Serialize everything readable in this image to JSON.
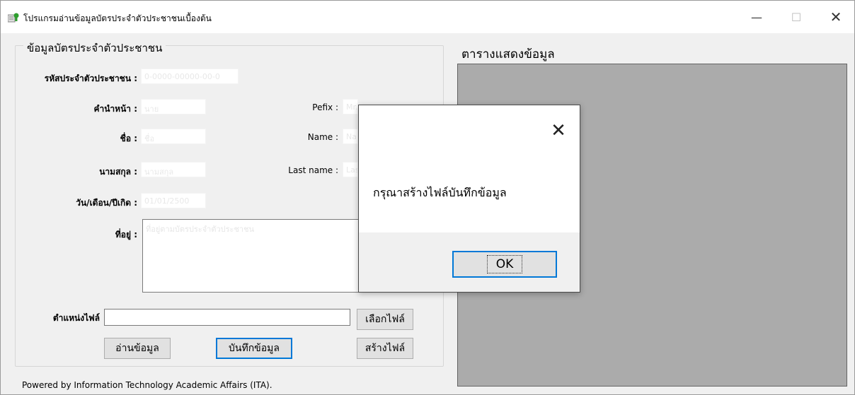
{
  "window": {
    "title": "โปรแกรมอ่านข้อมูลบัตรประจำตัวประชาชนเบื้องต้น",
    "minimize": "—",
    "maximize": "☐",
    "close": "✕"
  },
  "form": {
    "group_title": "ข้อมูลบัตรประจำตัวประชาชน",
    "citizen_id_label": "รหัสประจำตัวประชาชน :",
    "citizen_id_value": "0-0000-00000-00-0",
    "prefix_th_label": "คำนำหน้า :",
    "prefix_th_value": "นาย",
    "prefix_en_label": "Pefix :",
    "prefix_en_value": "Mr.",
    "name_th_label": "ชื่อ :",
    "name_th_value": "ชื่อ",
    "name_en_label": "Name :",
    "name_en_value": "Name",
    "lastname_th_label": "นามสกุล :",
    "lastname_th_value": "นามสกุล",
    "lastname_en_label": "Last name :",
    "lastname_en_value": "Lastname",
    "birthdate_label": "วัน/เดือน/ปีเกิด :",
    "birthdate_value": "01/01/2500",
    "address_label": "ที่อยู่ :",
    "address_value": "ที่อยู่ตามบัตรประจำตัวประชาชน",
    "filepath_label": "ตำแหน่งไฟล์",
    "filepath_value": "",
    "choose_file_button": "เลือกไฟล์",
    "read_button": "อ่านข้อมูล",
    "save_button": "บันทึกข้อมูล",
    "create_file_button": "สร้างไฟล์"
  },
  "table": {
    "title": "ตารางแสดงข้อมูล"
  },
  "footer": {
    "text": "Powered by Information Technology Academic Affairs (ITA)."
  },
  "dialog": {
    "message": "กรุณาสร้างไฟล์บันทึกข้อมูล",
    "ok_label": "OK",
    "close": "✕"
  },
  "colors": {
    "accent": "#0078d7",
    "grid_bg": "#ababab",
    "window_bg": "#f0f0f0"
  }
}
